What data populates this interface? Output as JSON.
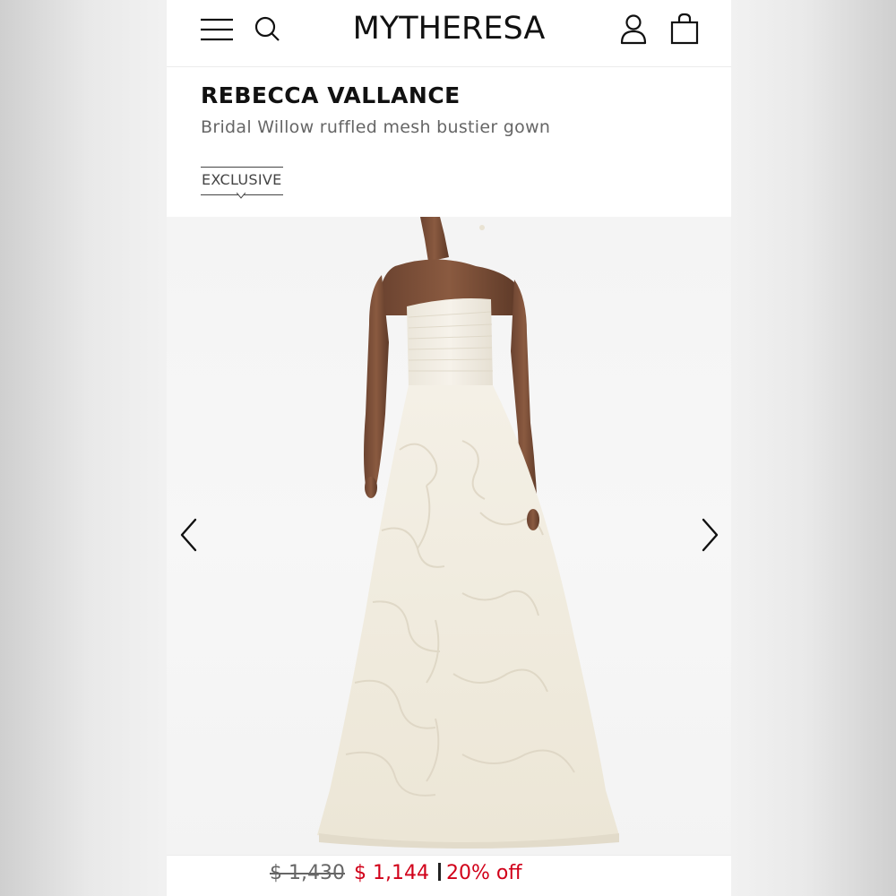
{
  "header": {
    "logo": "MYTHERESA",
    "menu_icon": "hamburger-menu-icon",
    "search_icon": "search-icon",
    "account_icon": "user-icon",
    "bag_icon": "shopping-bag-icon"
  },
  "product": {
    "brand": "REBECCA VALLANCE",
    "name": "Bridal Willow ruffled mesh bustier gown",
    "badge": "EXCLUSIVE"
  },
  "gallery": {
    "prev_icon": "chevron-left-icon",
    "next_icon": "chevron-right-icon"
  },
  "price": {
    "original": "$ 1,430",
    "sale": "$ 1,144",
    "discount": "20% off"
  },
  "colors": {
    "sale_red": "#d10019",
    "text_dark": "#111111",
    "text_muted": "#666666"
  }
}
